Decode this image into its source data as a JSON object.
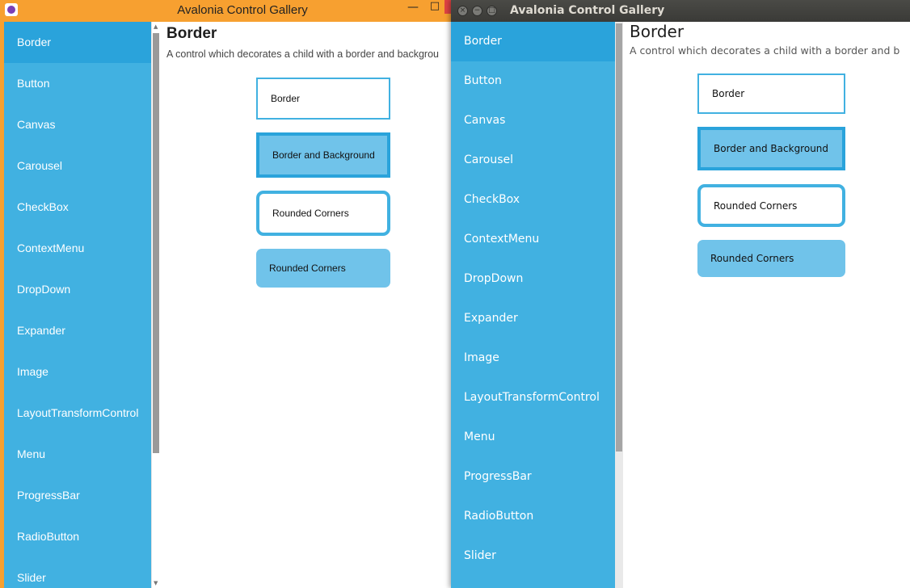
{
  "colors": {
    "accent": "#41b1e1",
    "accent_selected": "#2aa3db",
    "demo_background": "#70c3ea",
    "win1_frame": "#f7a030",
    "win2_titlebar": "#3c3b37"
  },
  "window1": {
    "title": "Avalonia Control Gallery",
    "icon": "avalonia-logo-icon",
    "controls": {
      "minimize": "—",
      "maximize": "□"
    },
    "nav_items": [
      {
        "label": "Border"
      },
      {
        "label": "Button"
      },
      {
        "label": "Canvas"
      },
      {
        "label": "Carousel"
      },
      {
        "label": "CheckBox"
      },
      {
        "label": "ContextMenu"
      },
      {
        "label": "DropDown"
      },
      {
        "label": "Expander"
      },
      {
        "label": "Image"
      },
      {
        "label": "LayoutTransformControl"
      },
      {
        "label": "Menu"
      },
      {
        "label": "ProgressBar"
      },
      {
        "label": "RadioButton"
      },
      {
        "label": "Slider"
      }
    ],
    "selected_item": "Border",
    "page": {
      "title": "Border",
      "description": "A control which decorates a child with a border and backgrou"
    },
    "demos": {
      "border": "Border",
      "border_background": "Border and Background",
      "rounded": "Rounded Corners",
      "rounded_background": "Rounded Corners"
    }
  },
  "window2": {
    "title": "Avalonia Control Gallery",
    "nav_items": [
      {
        "label": "Border"
      },
      {
        "label": "Button"
      },
      {
        "label": "Canvas"
      },
      {
        "label": "Carousel"
      },
      {
        "label": "CheckBox"
      },
      {
        "label": "ContextMenu"
      },
      {
        "label": "DropDown"
      },
      {
        "label": "Expander"
      },
      {
        "label": "Image"
      },
      {
        "label": "LayoutTransformControl"
      },
      {
        "label": "Menu"
      },
      {
        "label": "ProgressBar"
      },
      {
        "label": "RadioButton"
      },
      {
        "label": "Slider"
      }
    ],
    "selected_item": "Border",
    "page": {
      "title": "Border",
      "description": "A control which decorates a child with a border and b"
    },
    "demos": {
      "border": "Border",
      "border_background": "Border and Background",
      "rounded": "Rounded Corners",
      "rounded_background": "Rounded Corners"
    }
  }
}
